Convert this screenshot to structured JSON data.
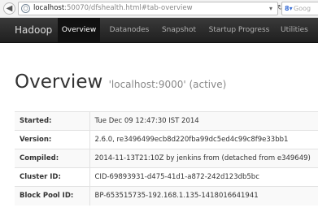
{
  "browser": {
    "url_host": "localhost",
    "url_rest": ":50070/dfshealth.html#tab-overview",
    "search_placeholder": "Goog"
  },
  "navbar": {
    "brand": "Hadoop",
    "items": [
      "Overview",
      "Datanodes",
      "Snapshot",
      "Startup Progress",
      "Utilities"
    ],
    "active_index": 0
  },
  "page": {
    "title": "Overview",
    "subtitle": "'localhost:9000' (active)"
  },
  "info_rows": [
    {
      "label": "Started:",
      "value": "Tue Dec 09 12:47:30 IST 2014"
    },
    {
      "label": "Version:",
      "value": "2.6.0, re3496499ecb8d220fba99dc5ed4c99c8f9e33bb1"
    },
    {
      "label": "Compiled:",
      "value": "2014-11-13T21:10Z by jenkins from (detached from e349649)"
    },
    {
      "label": "Cluster ID:",
      "value": "CID-69893931-d475-41d1-a872-242d123db5bc"
    },
    {
      "label": "Block Pool ID:",
      "value": "BP-653515735-192.168.1.135-1418016641941"
    }
  ],
  "colors": {
    "navbar_bg": "#222222",
    "navbar_active_bg": "#111111",
    "title_text": "#333333",
    "subtitle_text": "#888888"
  }
}
